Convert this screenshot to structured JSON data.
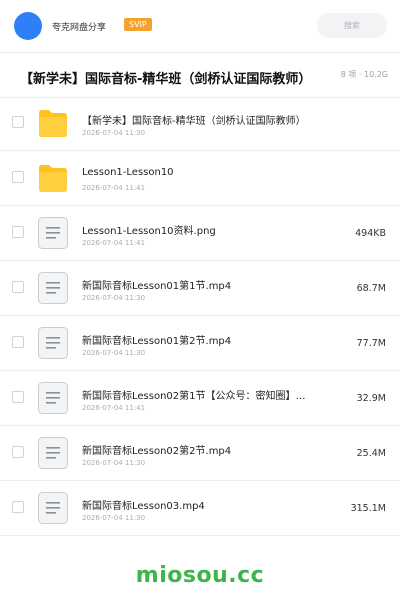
{
  "header": {
    "username": "夸克网盘分享",
    "badge": "SVIP",
    "search_placeholder": "搜索"
  },
  "folder": {
    "title": "【新学未】国际音标-精华班（剑桥认证国际教师）",
    "meta": "8 项 · 10.2G"
  },
  "files": [
    {
      "name": "【新学未】国际音标-精华班（剑桥认证国际教师）",
      "date": "2026-07-04 11:30",
      "size": "",
      "type": "folder"
    },
    {
      "name": "Lesson1-Lesson10",
      "date": "2026-07-04 11:41",
      "size": "",
      "type": "folder"
    },
    {
      "name": "Lesson1-Lesson10资料.png",
      "date": "2026-07-04 11:41",
      "size": "494KB",
      "type": "file"
    },
    {
      "name": "新国际音标Lesson01第1节.mp4",
      "date": "2026-07-04 11:30",
      "size": "68.7M",
      "type": "file"
    },
    {
      "name": "新国际音标Lesson01第2节.mp4",
      "date": "2026-07-04 11:30",
      "size": "77.7M",
      "type": "file"
    },
    {
      "name": "新国际音标Lesson02第1节【公众号：密知圈】…",
      "date": "2026-07-04 11:41",
      "size": "32.9M",
      "type": "file"
    },
    {
      "name": "新国际音标Lesson02第2节.mp4",
      "date": "2026-07-04 11:30",
      "size": "25.4M",
      "type": "file"
    },
    {
      "name": "新国际音标Lesson03.mp4",
      "date": "2026-07-04 11:30",
      "size": "315.1M",
      "type": "file"
    }
  ],
  "watermark": "miosou.cc",
  "colors": {
    "accent": "#2f7ff7",
    "svip": "#f6a12b",
    "folder": "#ffc21c",
    "watermark": "#3db54a"
  }
}
